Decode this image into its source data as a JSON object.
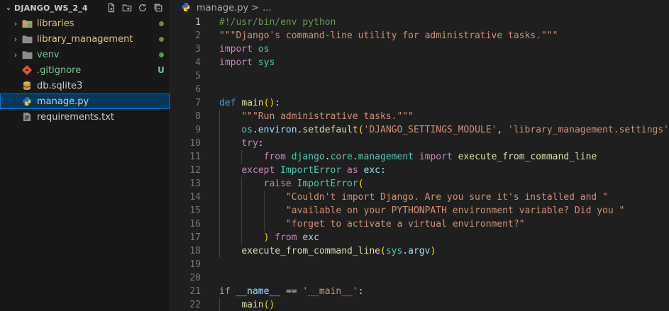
{
  "explorer": {
    "title": "DJANGO_WS_2_4",
    "actions": [
      "new-file-icon",
      "new-folder-icon",
      "refresh-icon",
      "collapse-all-icon"
    ],
    "items": [
      {
        "label": "libraries",
        "type": "folder",
        "status": "modified-dot",
        "status_color": "#8b8b8b"
      },
      {
        "label": "library_management",
        "type": "folder",
        "status": "modified-dot",
        "status_color": "#8b8b8b"
      },
      {
        "label": "venv",
        "type": "folder",
        "status": "untracked-dot",
        "status_color": "#4b9a5c"
      },
      {
        "label": ".gitignore",
        "type": "file",
        "icon": "git-icon",
        "status": "U",
        "status_color": "#73c991"
      },
      {
        "label": "db.sqlite3",
        "type": "file",
        "icon": "database-icon"
      },
      {
        "label": "manage.py",
        "type": "file",
        "icon": "python-icon",
        "selected": true
      },
      {
        "label": "requirements.txt",
        "type": "file",
        "icon": "text-file-icon"
      }
    ]
  },
  "breadcrumb": {
    "file": "manage.py",
    "separator": ">",
    "ellipsis": "..."
  },
  "editor": {
    "current_line": 1,
    "lines": [
      "#!/usr/bin/env python",
      "\"\"\"Django's command-line utility for administrative tasks.\"\"\"",
      "import os",
      "import sys",
      "",
      "",
      "def main():",
      "    \"\"\"Run administrative tasks.\"\"\"",
      "    os.environ.setdefault('DJANGO_SETTINGS_MODULE', 'library_management.settings')",
      "    try:",
      "        from django.core.management import execute_from_command_line",
      "    except ImportError as exc:",
      "        raise ImportError(",
      "            \"Couldn't import Django. Are you sure it's installed and \"",
      "            \"available on your PYTHONPATH environment variable? Did you \"",
      "            \"forget to activate a virtual environment?\"",
      "        ) from exc",
      "    execute_from_command_line(sys.argv)",
      "",
      "",
      "if __name__ == '__main__':",
      "    main()"
    ],
    "line_numbers": [
      "1",
      "2",
      "3",
      "4",
      "5",
      "6",
      "7",
      "8",
      "9",
      "10",
      "11",
      "12",
      "13",
      "14",
      "15",
      "16",
      "17",
      "18",
      "19",
      "20",
      "21",
      "22"
    ]
  }
}
